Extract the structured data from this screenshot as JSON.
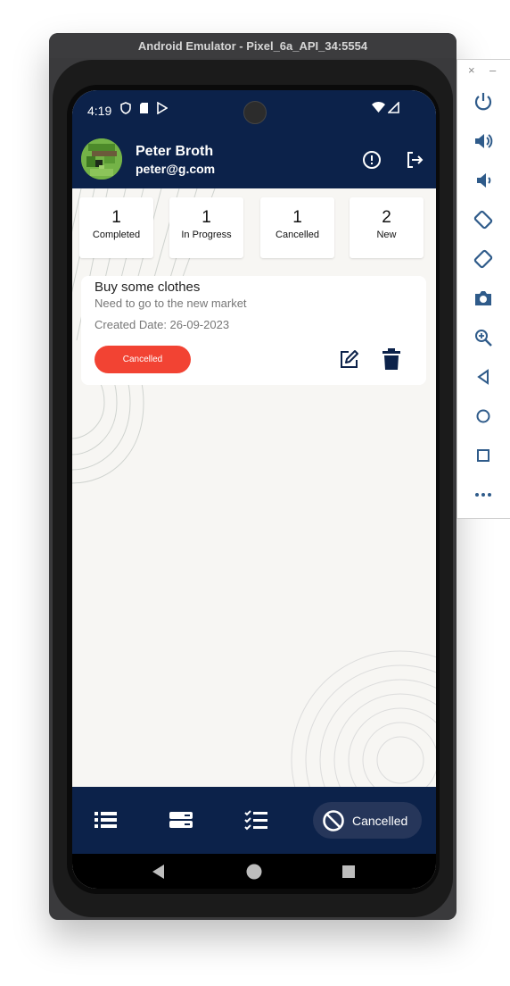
{
  "emulator": {
    "title": "Android Emulator - Pixel_6a_API_34:5554",
    "close_symbol": "×",
    "minimize_symbol": "–"
  },
  "status_bar": {
    "time": "4:19"
  },
  "user": {
    "name": "Peter Broth",
    "email": "peter@g.com"
  },
  "stats": [
    {
      "count": "1",
      "label": "Completed"
    },
    {
      "count": "1",
      "label": "In Progress"
    },
    {
      "count": "1",
      "label": "Cancelled"
    },
    {
      "count": "2",
      "label": "New"
    }
  ],
  "tasks": [
    {
      "title": "Buy some clothes",
      "description": "Need to go to the new market",
      "created_date": "Created Date: 26-09-2023",
      "status": "Cancelled"
    }
  ],
  "bottom_nav": {
    "active_label": "Cancelled"
  },
  "colors": {
    "primary": "#0c224a",
    "cancelled": "#f24333",
    "background": "#f7f6f3"
  },
  "icons": [
    "info-icon",
    "logout-icon",
    "edit-icon",
    "delete-icon",
    "list-icon",
    "progress-icon",
    "checklist-icon",
    "cancel-icon",
    "power-icon",
    "volume-up-icon",
    "volume-down-icon",
    "rotate-left-icon",
    "rotate-right-icon",
    "camera-icon",
    "zoom-icon",
    "back-icon",
    "home-icon",
    "overview-icon",
    "more-icon"
  ]
}
